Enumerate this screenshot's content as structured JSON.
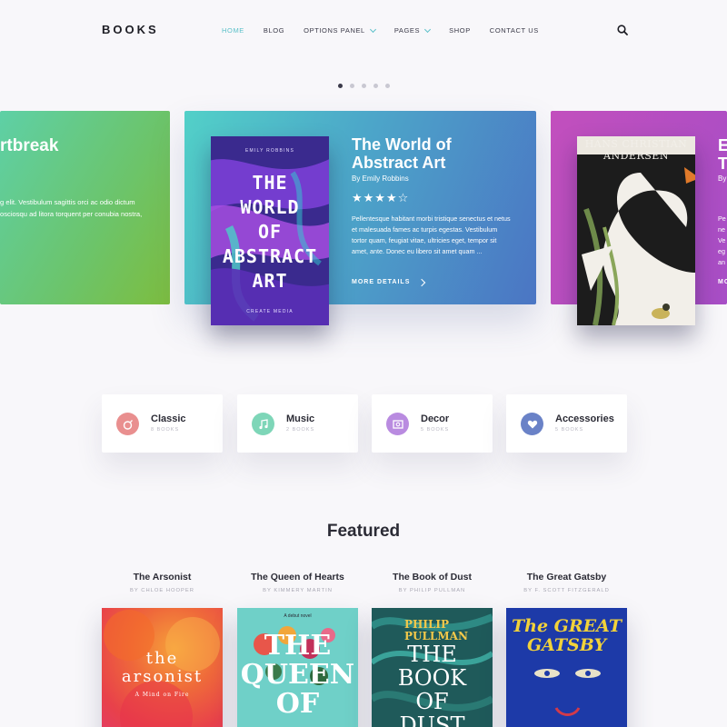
{
  "header": {
    "logo": "BOOKS",
    "nav": [
      {
        "label": "HOME",
        "active": true,
        "dropdown": false
      },
      {
        "label": "BLOG",
        "active": false,
        "dropdown": false
      },
      {
        "label": "OPTIONS PANEL",
        "active": false,
        "dropdown": true
      },
      {
        "label": "PAGES",
        "active": false,
        "dropdown": true
      },
      {
        "label": "SHOP",
        "active": false,
        "dropdown": false
      },
      {
        "label": "CONTACT US",
        "active": false,
        "dropdown": false
      }
    ],
    "search_icon": "search-icon"
  },
  "slider": {
    "dots": 5,
    "active_dot": 1,
    "left": {
      "title_fragment": "rtbreak",
      "desc_fragment": "g elit. Vestibulum sagittis orci ac odio dictum\nosciosqu ad litora torquent per conubia nostra,"
    },
    "center": {
      "title": "The World of Abstract Art",
      "author": "By Emily Robbins",
      "rating": 4.5,
      "stars_text": "★★★★☆",
      "body": "Pellentesque habitant morbi tristique senectus et netus et malesuada fames ac turpis egestas. Vestibulum tortor quam, feugiat vitae, ultricies eget, tempor sit amet, ante. Donec eu libero sit amet quam ...",
      "more": "MORE DETAILS",
      "cover": {
        "author": "EMILY ROBBINS",
        "title": "THE WORLD OF ABSTRACT ART",
        "publisher": "CREATE MEDIA"
      }
    },
    "right": {
      "title_fragment": "E\nT",
      "author_fragment": "By",
      "body_fragment": "Pe\nne\nVe\neg\nan",
      "more_fragment": "MO",
      "cover_title": "HANS CHRISTIAN\nANDERSEN"
    }
  },
  "categories": [
    {
      "name": "Classic",
      "count": "8 BOOKS",
      "icon": "bomb-icon",
      "color": "#e98f8f"
    },
    {
      "name": "Music",
      "count": "2 BOOKS",
      "icon": "music-note-icon",
      "color": "#7ed6b8"
    },
    {
      "name": "Decor",
      "count": "5 BOOKS",
      "icon": "picture-icon",
      "color": "#b98be0"
    },
    {
      "name": "Accessories",
      "count": "5 BOOKS",
      "icon": "heart-icon",
      "color": "#6a82c7"
    }
  ],
  "featured": {
    "title": "Featured",
    "books": [
      {
        "title": "The Arsonist",
        "author": "BY CHLOE HOOPER",
        "cover_text": "the\narsonist",
        "cover_sub": "A Mind on Fire"
      },
      {
        "title": "The Queen of Hearts",
        "author": "BY KIMMERY MARTIN",
        "cover_text": "THE\nQUEEN\nOF",
        "cover_sub": "A debut novel"
      },
      {
        "title": "The Book of Dust",
        "author": "BY PHILIP PULLMAN",
        "cover_text": "THE\nBOOK\nOF\nDUST",
        "cover_sub": "PHILIP\nPULLMAN"
      },
      {
        "title": "The Great Gatsby",
        "author": "BY F. SCOTT FITZGERALD",
        "cover_text": "The GREAT\nGATSBY",
        "cover_sub": ""
      }
    ]
  },
  "colors": {
    "accent": "#5bc0c9",
    "background": "#f8f7fa",
    "text": "#2b2b35"
  }
}
